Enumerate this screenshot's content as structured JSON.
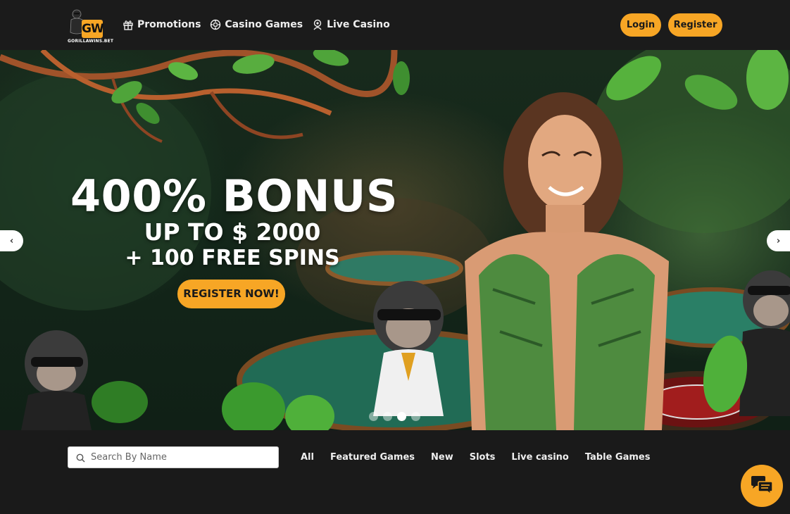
{
  "brand": {
    "logo_letters": "GW",
    "logo_wordmark": "GORILLAWINS.BET",
    "accent_color": "#f7a625",
    "background_color": "#1a1a1a"
  },
  "nav": {
    "items": [
      {
        "label": "Promotions",
        "icon": "gift-icon"
      },
      {
        "label": "Casino Games",
        "icon": "casino-chip-icon"
      },
      {
        "label": "Live Casino",
        "icon": "dealer-icon"
      }
    ]
  },
  "auth": {
    "login_label": "Login",
    "register_label": "Register"
  },
  "hero": {
    "title": "400% BONUS",
    "subtitle_line1": "UP TO $ 2000",
    "subtitle_line2": "+ 100 FREE SPINS",
    "cta_label": "REGISTER NOW!",
    "prev_icon": "chevron-left-icon",
    "next_icon": "chevron-right-icon",
    "prev_glyph": "‹",
    "next_glyph": "›",
    "slides_total": 4,
    "active_slide": 3
  },
  "games": {
    "search_placeholder": "Search By Name",
    "search_value": "",
    "filters": [
      "All",
      "Featured Games",
      "New",
      "Slots",
      "Live casino",
      "Table Games"
    ]
  },
  "chat": {
    "icon": "chat-bubbles-icon"
  }
}
